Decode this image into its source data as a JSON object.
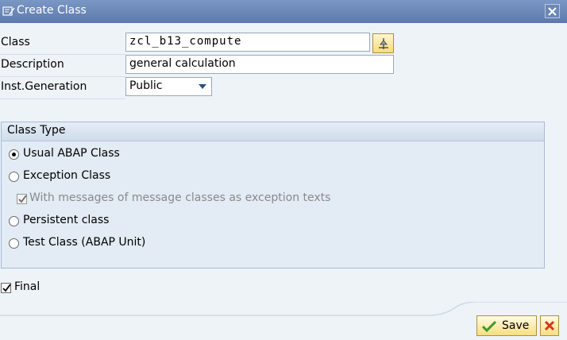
{
  "window": {
    "title": "Create Class",
    "close_icon": "close-icon"
  },
  "form": {
    "class_label": "Class",
    "class_value": "zcl_b13_compute",
    "description_label": "Description",
    "description_value": "general calculation",
    "inst_generation_label": "Inst.Generation",
    "inst_generation_value": "Public"
  },
  "class_type": {
    "title": "Class Type",
    "options": [
      {
        "label": "Usual ABAP Class",
        "selected": true
      },
      {
        "label": "Exception Class",
        "selected": false
      },
      {
        "label": "Persistent class",
        "selected": false
      },
      {
        "label": "Test Class (ABAP Unit)",
        "selected": false
      }
    ],
    "message_checkbox_label": "With messages of message classes as exception texts",
    "message_checkbox_checked": true,
    "message_checkbox_enabled": false
  },
  "final": {
    "label": "Final",
    "checked": true
  },
  "footer": {
    "save_label": "Save",
    "cancel_icon": "cancel-icon"
  },
  "colors": {
    "title_bar": "#6683b4",
    "background": "#eef3f8",
    "group_background": "#e3ebf5",
    "button_yellow": "#f7de7e"
  }
}
